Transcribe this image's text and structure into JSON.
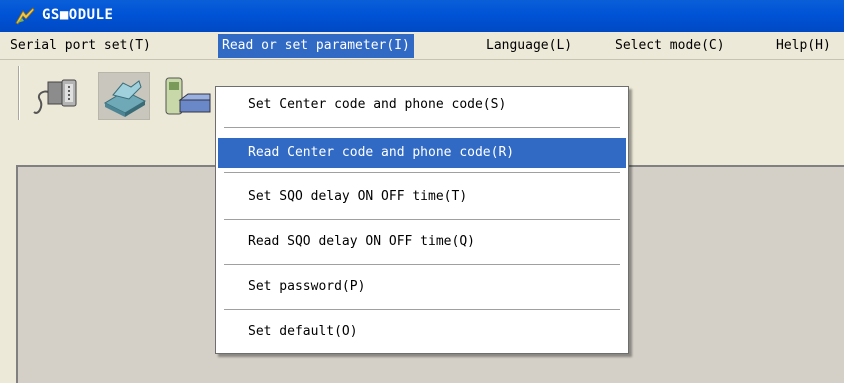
{
  "window": {
    "title": "GS■ODULE"
  },
  "menubar": {
    "items": [
      {
        "label": "Serial port set(T)"
      },
      {
        "label": "Read or set parameter(I)"
      },
      {
        "label": "Language(L)"
      },
      {
        "label": "Select mode(C)"
      },
      {
        "label": "Help(H)"
      }
    ]
  },
  "toolbar": {
    "buttons": [
      {
        "icon": "serial-port-icon"
      },
      {
        "icon": "hand-card-icon"
      },
      {
        "icon": "phone-module-icon"
      }
    ]
  },
  "dropdown": {
    "items": [
      {
        "label": "Set Center code and phone code(S)",
        "highlighted": false
      },
      {
        "label": "Read Center code and phone code(R)",
        "highlighted": true
      },
      {
        "label": "Set SQO delay ON OFF time(T)",
        "highlighted": false
      },
      {
        "label": "Read SQO delay ON OFF time(Q)",
        "highlighted": false
      },
      {
        "label": "Set password(P)",
        "highlighted": false
      },
      {
        "label": "Set default(O)",
        "highlighted": false
      }
    ]
  },
  "colors": {
    "titlebar": "#0053d6",
    "highlight": "#316ac5",
    "menubar": "#ece9d8"
  }
}
